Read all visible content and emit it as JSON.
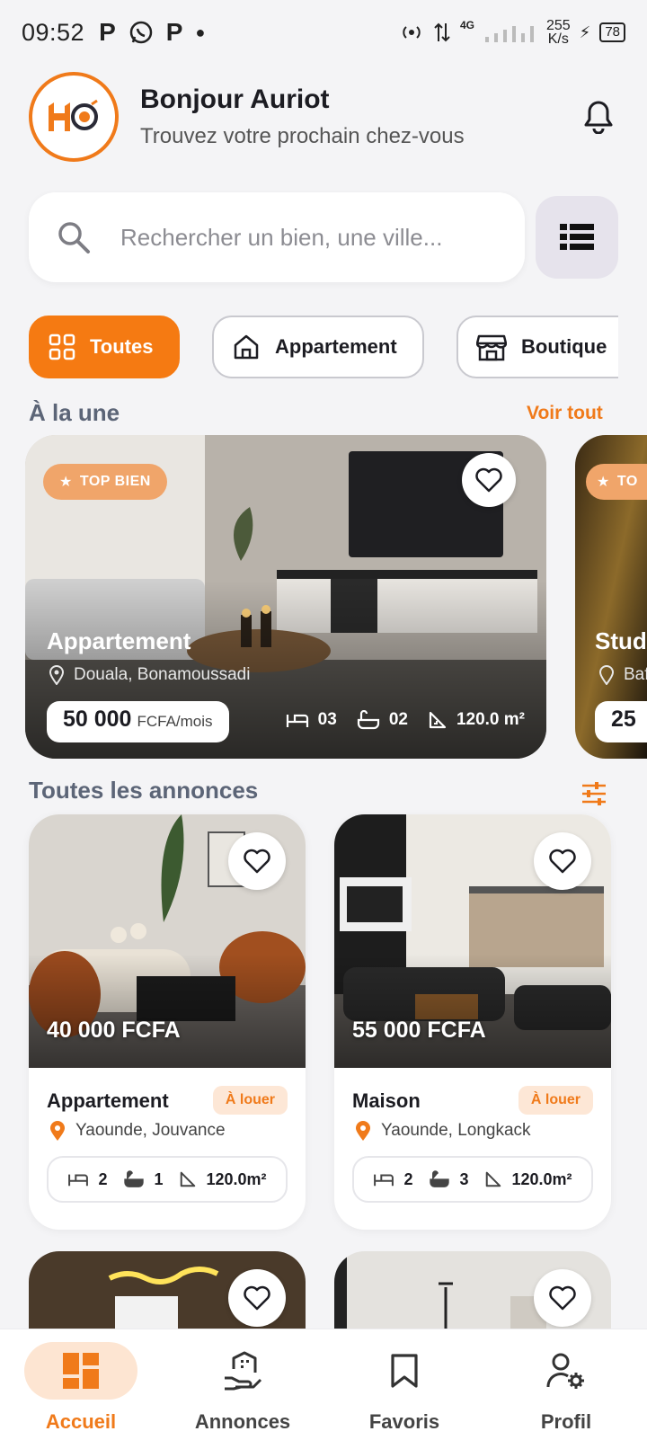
{
  "status_bar": {
    "time": "09:52",
    "net_speed": "255",
    "net_unit": "K/s",
    "network": "4G",
    "battery": "78"
  },
  "header": {
    "logo_text": "HO",
    "greeting": "Bonjour Auriot",
    "subtitle": "Trouvez votre prochain chez-vous"
  },
  "search": {
    "placeholder": "Rechercher un bien, une ville..."
  },
  "categories": [
    {
      "label": "Toutes",
      "icon": "grid-icon",
      "active": true
    },
    {
      "label": "Appartement",
      "icon": "home-icon",
      "active": false
    },
    {
      "label": "Boutique",
      "icon": "store-icon",
      "active": false
    }
  ],
  "featured_section": {
    "title": "À la une",
    "link": "Voir tout"
  },
  "featured": [
    {
      "badge": "TOP BIEN",
      "type": "Appartement",
      "location": "Douala, Bonamoussadi",
      "price": "50 000",
      "price_unit": "FCFA/mois",
      "bedrooms": "03",
      "bathrooms": "02",
      "area": "120.0 m²"
    },
    {
      "badge": "TO",
      "type": "Stud",
      "location": "Baf",
      "price": "25"
    }
  ],
  "listings_section": {
    "title": "Toutes les annonces"
  },
  "listings": [
    {
      "price": "40 000 FCFA",
      "type": "Appartement",
      "status": "À louer",
      "location": "Yaounde, Jouvance",
      "bedrooms": "2",
      "bathrooms": "1",
      "area": "120.0m²"
    },
    {
      "price": "55 000 FCFA",
      "type": "Maison",
      "status": "À louer",
      "location": "Yaounde, Longkack",
      "bedrooms": "2",
      "bathrooms": "3",
      "area": "120.0m²"
    }
  ],
  "bottom_nav": [
    {
      "label": "Accueil",
      "icon": "dashboard-icon",
      "active": true
    },
    {
      "label": "Annonces",
      "icon": "building-hand-icon",
      "active": false
    },
    {
      "label": "Favoris",
      "icon": "bookmark-icon",
      "active": false
    },
    {
      "label": "Profil",
      "icon": "user-gear-icon",
      "active": false
    }
  ],
  "colors": {
    "accent": "#f57a12",
    "accent_soft": "#fde5d2",
    "background": "#f4f4f6"
  }
}
